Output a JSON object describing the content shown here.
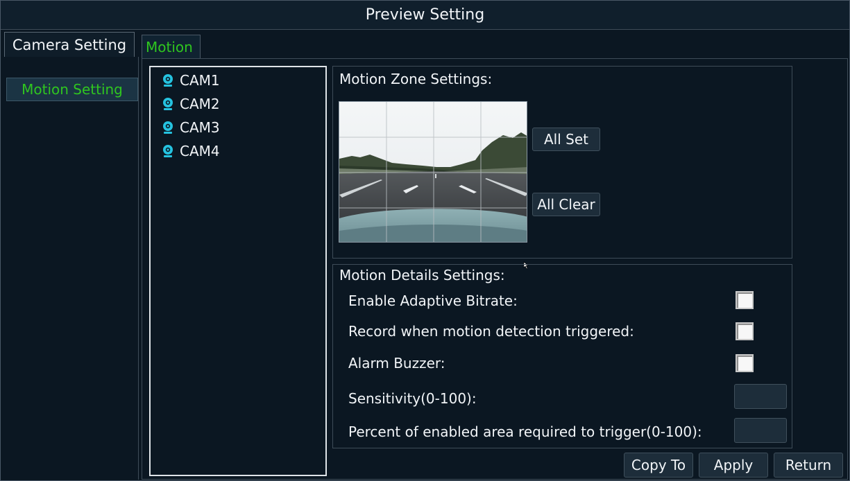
{
  "window": {
    "title": "Preview Setting"
  },
  "left_tab": {
    "label": "Camera Setting"
  },
  "left_menu": {
    "items": [
      {
        "label": "Motion Setting",
        "active": true
      }
    ]
  },
  "sub_tab": {
    "label": "Motion"
  },
  "cameras": [
    {
      "label": "CAM1",
      "icon": "camera-icon"
    },
    {
      "label": "CAM2",
      "icon": "camera-icon"
    },
    {
      "label": "CAM3",
      "icon": "camera-icon"
    },
    {
      "label": "CAM4",
      "icon": "camera-icon"
    }
  ],
  "zone": {
    "heading": "Motion Zone Settings:",
    "preview_image": "road-camera-preview",
    "grid": {
      "rows": 4,
      "cols": 4
    },
    "all_set_label": "All Set",
    "all_clear_label": "All Clear"
  },
  "details": {
    "heading": "Motion Details Settings:",
    "adaptive_bitrate": {
      "label": "Enable Adaptive Bitrate:",
      "checked": false
    },
    "record_on_motion": {
      "label": "Record when motion detection triggered:",
      "checked": false
    },
    "alarm_buzzer": {
      "label": "Alarm Buzzer:",
      "checked": false
    },
    "sensitivity": {
      "label": "Sensitivity(0-100):",
      "value": ""
    },
    "percent_area": {
      "label": "Percent of enabled area required to trigger(0-100):",
      "value": ""
    }
  },
  "footer": {
    "copy_to_label": "Copy To",
    "apply_label": "Apply",
    "return_label": "Return"
  },
  "colors": {
    "background": "#0b1722",
    "accent_green": "#2fc61f",
    "camera_icon": "#25c3e0",
    "button_bg": "#1d2d3a"
  }
}
